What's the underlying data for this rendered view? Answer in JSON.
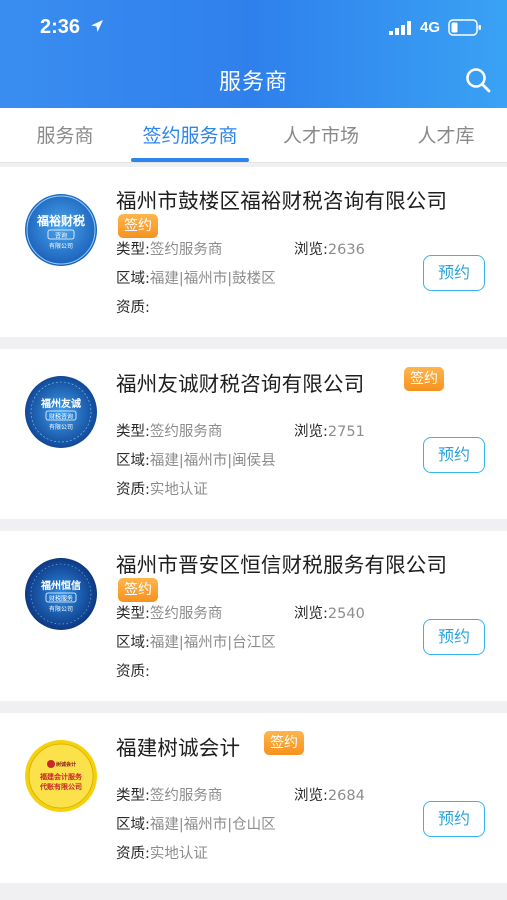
{
  "status_bar": {
    "time": "2:36",
    "network": "4G"
  },
  "nav": {
    "title": "服务商"
  },
  "tabs": [
    {
      "label": "服务商"
    },
    {
      "label": "签约服务商"
    },
    {
      "label": "人才市场"
    },
    {
      "label": "人才库"
    }
  ],
  "colors": {
    "header": "#2f80ec",
    "accent": "#2c84ec",
    "badge": "#f6921e",
    "book_border": "#36b3e8"
  },
  "labels": {
    "type": "类型:",
    "views": "浏览:",
    "region": "区域:",
    "qualification": "资质:",
    "book": "预约",
    "badge": "签约"
  },
  "providers": [
    {
      "name": "福州市鼓楼区福裕财税咨询有限公司",
      "logo_text": [
        "福裕财税",
        "咨询",
        "有限公司"
      ],
      "type": "签约服务商",
      "views": "2636",
      "region": "福建|福州市|鼓楼区",
      "qualification": ""
    },
    {
      "name": "福州友诚财税咨询有限公司",
      "logo_text": [
        "福州友诚",
        "财税咨询",
        "有限公司"
      ],
      "type": "签约服务商",
      "views": "2751",
      "region": "福建|福州市|闽侯县",
      "qualification": "实地认证"
    },
    {
      "name": "福州市晋安区恒信财税服务有限公司",
      "logo_text": [
        "福州恒信",
        "财税服务",
        "有限公司"
      ],
      "type": "签约服务商",
      "views": "2540",
      "region": "福建|福州市|台江区",
      "qualification": ""
    },
    {
      "name": "福建树诚会计",
      "logo_text": [
        "树诚会计",
        "福建会计服务",
        "代账有限公司"
      ],
      "type": "签约服务商",
      "views": "2684",
      "region": "福建|福州市|仓山区",
      "qualification": "实地认证"
    }
  ]
}
